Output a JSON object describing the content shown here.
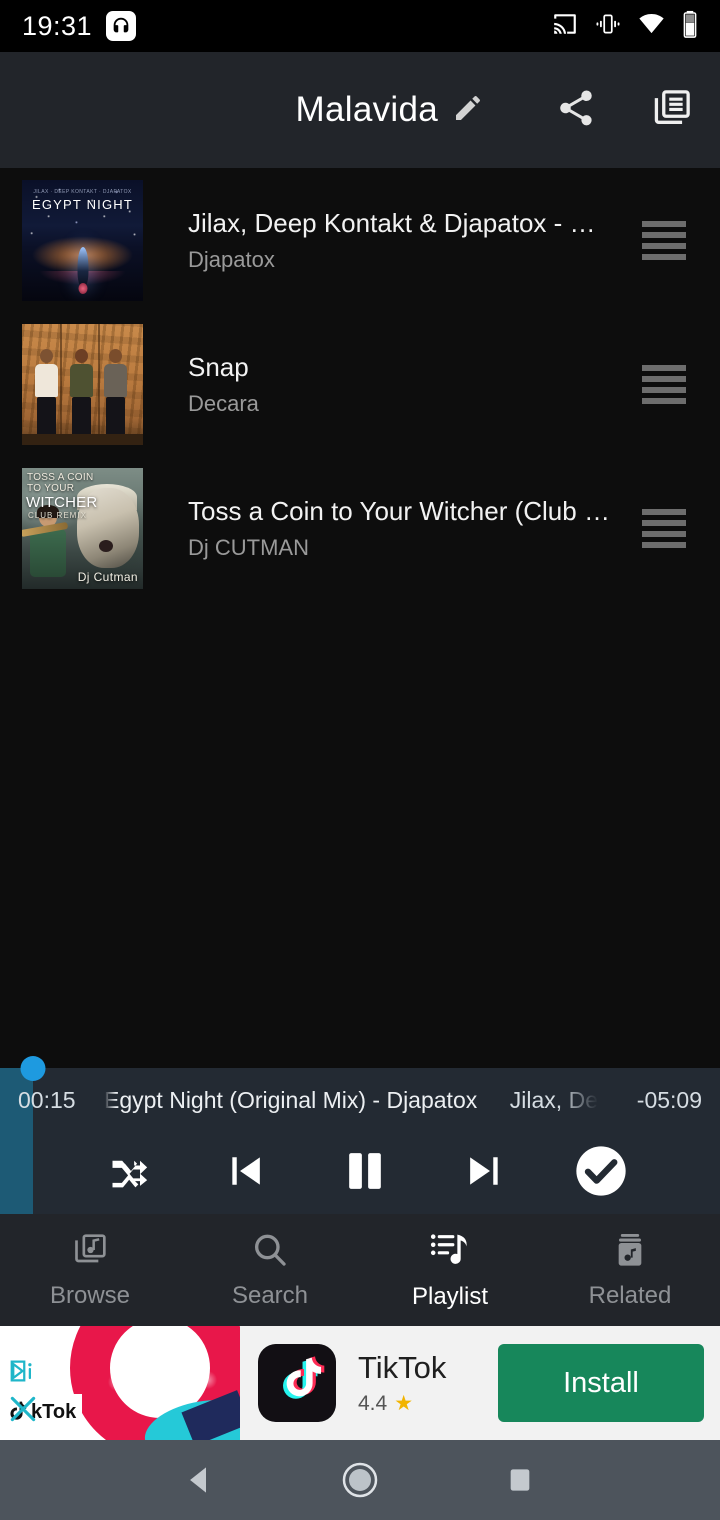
{
  "status_bar": {
    "time": "19:31",
    "icons": [
      "headphones-icon",
      "cast-icon",
      "vibrate-icon",
      "wifi-icon",
      "battery-icon"
    ]
  },
  "header": {
    "title": "Malavida",
    "edit_icon": "pencil-icon",
    "share_icon": "share-icon",
    "queue_icon": "library-queue-icon"
  },
  "tracks": [
    {
      "title": "Jilax, Deep Kontakt & Djapatox  - Egypt Night…",
      "artist": "Djapatox",
      "art_alt": "Egypt Night album art",
      "art_credits": "JILAX · DEEP KONTAKT · DJAPATOX",
      "art_title": "EGYPT NIGHT"
    },
    {
      "title": "Snap",
      "artist": "Decara",
      "art_alt": "Snap album art"
    },
    {
      "title": "Toss a Coin to Your Witcher (Club Remix)",
      "artist": "Dj CUTMAN",
      "art_alt": "Toss a Coin to Your Witcher album art",
      "art_line1": "TOSS A COIN",
      "art_line2": "TO YOUR",
      "art_line3": "WITCHER",
      "art_line4": "CLUB REMIX",
      "art_line5": "Dj Cutman"
    }
  ],
  "player": {
    "elapsed": "00:15",
    "remaining": "-05:09",
    "track": "Egypt Night (Original Mix) - Djapatox",
    "artist": "Jilax, De",
    "progress_percent": 4.6,
    "progress_color": "#1d5a75",
    "knob_color": "#1e9ae0",
    "controls": [
      {
        "name": "shuffle-button",
        "label": "shuffle"
      },
      {
        "name": "previous-button",
        "label": "previous"
      },
      {
        "name": "pause-button",
        "label": "pause"
      },
      {
        "name": "next-button",
        "label": "next"
      },
      {
        "name": "confirm-button",
        "label": "done"
      }
    ]
  },
  "bottom_nav": [
    {
      "label": "Browse",
      "icon": "browse-icon",
      "active": false
    },
    {
      "label": "Search",
      "icon": "search-icon",
      "active": false
    },
    {
      "label": "Playlist",
      "icon": "playlist-icon",
      "active": true
    },
    {
      "label": "Related",
      "icon": "related-icon",
      "active": false
    }
  ],
  "ad": {
    "app_name": "TikTok",
    "rating": "4.4",
    "star": "★",
    "install_label": "Install",
    "brand_label": "kTok",
    "install_color": "#17875b",
    "adchoices_icon": "adchoices-icon",
    "close_icon": "close-icon"
  },
  "android_nav": {
    "back": "back-button",
    "home": "home-button",
    "recents": "recents-button"
  }
}
